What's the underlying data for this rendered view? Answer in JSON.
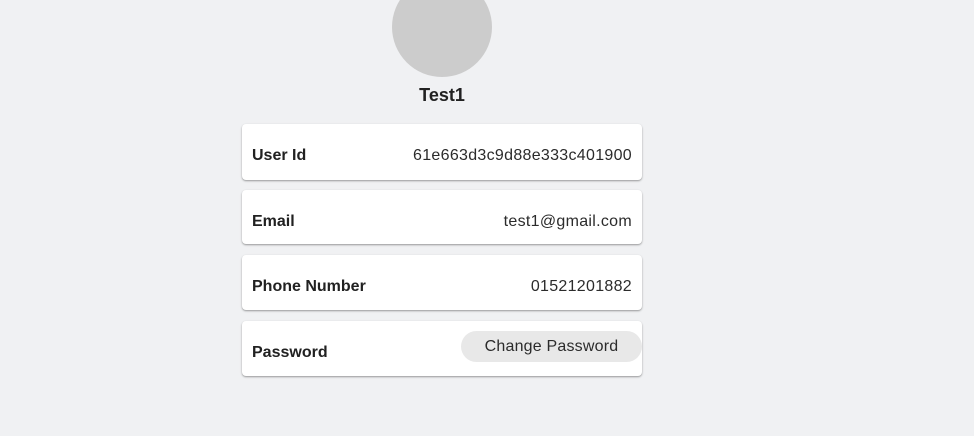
{
  "profile": {
    "username": "Test1"
  },
  "fields": {
    "user_id": {
      "label": "User Id",
      "value": "61e663d3c9d88e333c401900"
    },
    "email": {
      "label": "Email",
      "value": "test1@gmail.com"
    },
    "phone": {
      "label": "Phone Number",
      "value": "01521201882"
    },
    "password": {
      "label": "Password",
      "button_label": "Change Password"
    }
  },
  "colors": {
    "background": "#f0f1f3",
    "avatar": "#cccccc",
    "card": "#ffffff",
    "button": "#e8e8e8"
  }
}
